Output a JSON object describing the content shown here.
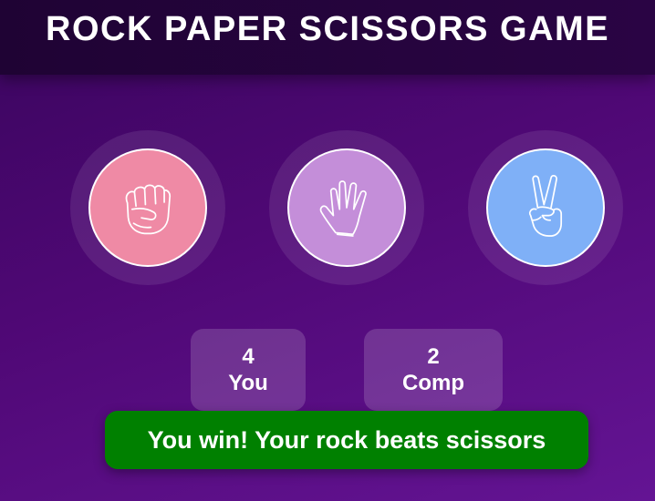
{
  "header": {
    "title": "ROCK PAPER SCISSORS GAME"
  },
  "choices": [
    {
      "id": "rock",
      "icon": "fist-icon",
      "color": "#ef8aa5"
    },
    {
      "id": "paper",
      "icon": "open-hand-icon",
      "color": "#c48ed9"
    },
    {
      "id": "scissors",
      "icon": "victory-hand-icon",
      "color": "#7fb0f7"
    }
  ],
  "scoreboard": {
    "user": {
      "score": "4",
      "label": "You"
    },
    "computer": {
      "score": "2",
      "label": "Comp"
    }
  },
  "result": {
    "message": "You win! Your rock beats scissors",
    "color": "#008000"
  }
}
